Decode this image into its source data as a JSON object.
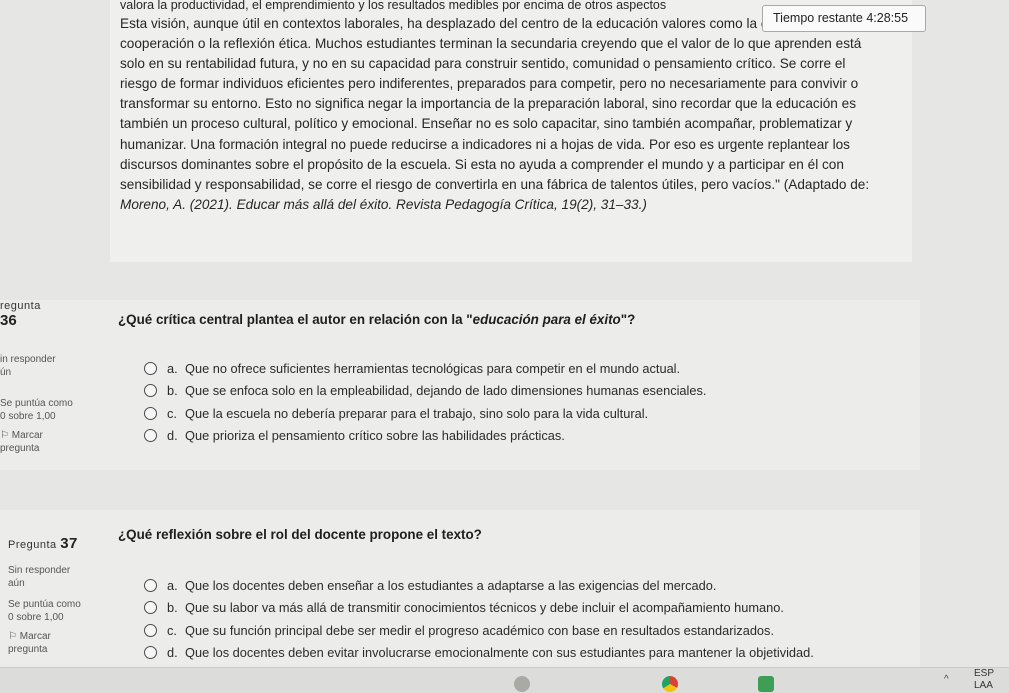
{
  "timer": {
    "label": "Tiempo restante 4:28:55"
  },
  "passage": {
    "lines": [
      "valora la productividad, el emprendimiento y los resultados medibles por encima de otros aspectos",
      "Esta visión, aunque útil en contextos laborales, ha desplazado del centro de la educación valores como la empatía, la",
      "cooperación o la reflexión ética. Muchos estudiantes terminan la secundaria creyendo que el valor de lo que aprenden está",
      "solo en su rentabilidad futura, y no en su capacidad para construir sentido, comunidad o pensamiento crítico. Se corre el",
      "riesgo de formar individuos eficientes pero indiferentes, preparados para competir, pero no necesariamente para convivir o",
      "transformar su entorno. Esto no significa negar la importancia de la preparación laboral, sino recordar que la educación es",
      "también un proceso cultural, político y emocional. Enseñar no es solo capacitar, sino también acompañar, problematizar y",
      "humanizar. Una formación integral no puede reducirse a indicadores ni a hojas de vida. Por eso es urgente replantear los",
      "discursos dominantes sobre el propósito de la escuela. Si esta no ayuda a comprender el mundo y a participar en él con",
      "sensibilidad y responsabilidad, se corre el riesgo de convertirla en una fábrica de talentos útiles, pero vacíos.\" (Adaptado de:"
    ],
    "reference": "Moreno, A. (2021). Educar más allá del éxito. Revista Pedagogía Crítica, 19(2), 31–33.)"
  },
  "questions": [
    {
      "title": "regunta",
      "number": "36",
      "status": "in responder",
      "status2": "ún",
      "score": "Se puntúa como",
      "score2": "0 sobre 1,00",
      "flag": "Marcar",
      "flag2": "pregunta",
      "text_pre": "¿Qué crítica central plantea el autor en relación con la \"",
      "text_em": "educación para el éxito",
      "text_post": "\"?",
      "options": [
        {
          "letter": "a.",
          "text": "Que no ofrece suficientes herramientas tecnológicas para competir en el mundo actual."
        },
        {
          "letter": "b.",
          "text": "Que se enfoca solo en la empleabilidad, dejando de lado dimensiones humanas esenciales."
        },
        {
          "letter": "c.",
          "text": "Que la escuela no debería preparar para el trabajo, sino solo para la vida cultural."
        },
        {
          "letter": "d.",
          "text": "Que prioriza el pensamiento crítico sobre las habilidades prácticas."
        }
      ]
    },
    {
      "title": "Pregunta",
      "number": "37",
      "status": "Sin responder",
      "status2": "aún",
      "score": "Se puntúa como",
      "score2": "0 sobre 1,00",
      "flag": "Marcar",
      "flag2": "pregunta",
      "text": "¿Qué reflexión sobre el rol del docente propone el texto?",
      "options": [
        {
          "letter": "a.",
          "text": "Que los docentes deben enseñar a los estudiantes a adaptarse a las exigencias del mercado."
        },
        {
          "letter": "b.",
          "text": "Que su labor va más allá de transmitir conocimientos técnicos y debe incluir el acompañamiento humano."
        },
        {
          "letter": "c.",
          "text": "Que su función principal debe ser medir el progreso académico con base en resultados estandarizados."
        },
        {
          "letter": "d.",
          "text": "Que los docentes deben evitar involucrarse emocionalmente con sus estudiantes para mantener la objetividad."
        }
      ]
    }
  ],
  "taskbar": {
    "lang1": "ESP",
    "lang2": "LAA"
  }
}
